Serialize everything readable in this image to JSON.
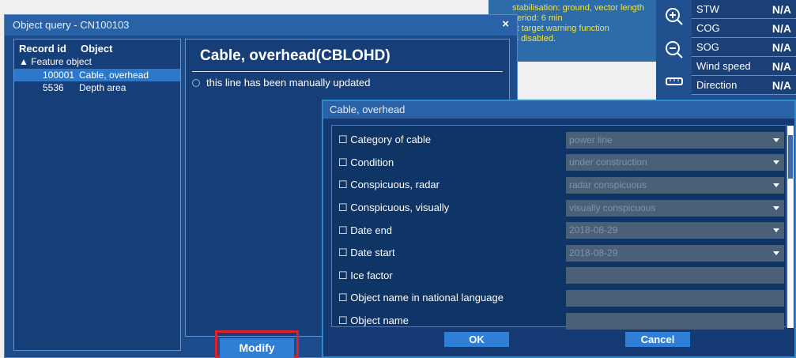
{
  "notice": {
    "lines": [
      "stabilisation: ground, vector length",
      "period: 6 min",
      "st target warning function",
      "is disabled."
    ]
  },
  "nav_data": [
    {
      "label": "STW",
      "value": "N/A"
    },
    {
      "label": "COG",
      "value": "N/A"
    },
    {
      "label": "SOG",
      "value": "N/A"
    },
    {
      "label": "Wind speed",
      "value": "N/A"
    },
    {
      "label": "Direction",
      "value": "N/A"
    }
  ],
  "object_query": {
    "title": "Object query - CN100103",
    "close_glyph": "×",
    "columns": {
      "record_id": "Record id",
      "object": "Object"
    },
    "group_label": "▲ Feature object",
    "rows": [
      {
        "id": "100001",
        "object": "Cable, overhead"
      },
      {
        "id": "5536",
        "object": "Depth area"
      }
    ],
    "detail_title": "Cable, overhead(CBLOHD)",
    "detail_note": "this line has been manually updated",
    "modify_label": "Modify"
  },
  "cable_dialog": {
    "title": "Cable, overhead",
    "attributes": [
      {
        "label": "☐ Category of cable",
        "value": "power line",
        "dropdown": true
      },
      {
        "label": "☐ Condition",
        "value": "under construction",
        "dropdown": true
      },
      {
        "label": "☐ Conspicuous, radar",
        "value": "radar conspicuous",
        "dropdown": true
      },
      {
        "label": "☐ Conspicuous, visually",
        "value": "visually conspicuous",
        "dropdown": true
      },
      {
        "label": "☐ Date end",
        "value": "2018-08-29",
        "dropdown": true
      },
      {
        "label": "☐ Date start",
        "value": "2018-08-29",
        "dropdown": true
      },
      {
        "label": "☐ Ice factor",
        "value": "",
        "dropdown": false
      },
      {
        "label": "☐ Object name in national language",
        "value": "",
        "dropdown": false
      },
      {
        "label": "☐ Object name",
        "value": "",
        "dropdown": false
      }
    ],
    "ok_label": "OK",
    "cancel_label": "Cancel"
  }
}
